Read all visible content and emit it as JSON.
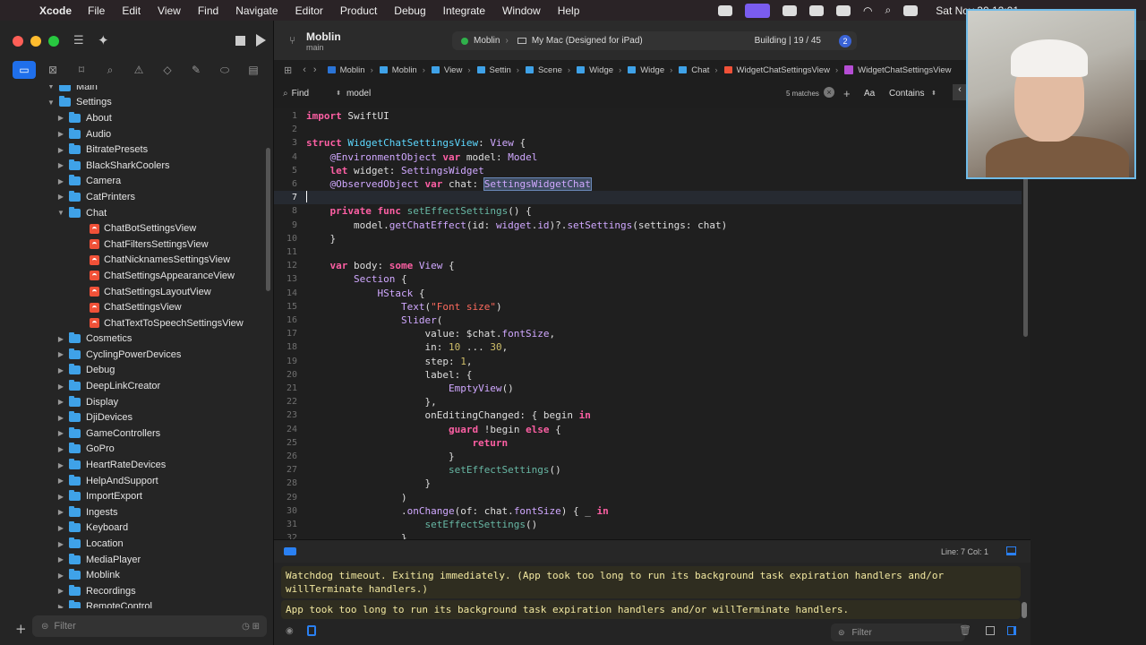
{
  "menubar": {
    "app": "Xcode",
    "items": [
      "File",
      "Edit",
      "View",
      "Find",
      "Navigate",
      "Editor",
      "Product",
      "Debug",
      "Integrate",
      "Window",
      "Help"
    ],
    "clock": "Sat Nov 30 12:01"
  },
  "toolbar": {
    "project": "Moblin",
    "branch": "main",
    "scheme": "Moblin",
    "destination": "My Mac (Designed for iPad)",
    "status": "Building | 19 / 45",
    "badge": "2"
  },
  "navigator": {
    "rows": [
      {
        "label": "Main",
        "depth": 1,
        "kind": "folder",
        "open": true
      },
      {
        "label": "Settings",
        "depth": 1,
        "kind": "folder",
        "open": true
      },
      {
        "label": "About",
        "depth": 2,
        "kind": "folder"
      },
      {
        "label": "Audio",
        "depth": 2,
        "kind": "folder"
      },
      {
        "label": "BitratePresets",
        "depth": 2,
        "kind": "folder"
      },
      {
        "label": "BlackSharkCoolers",
        "depth": 2,
        "kind": "folder"
      },
      {
        "label": "Camera",
        "depth": 2,
        "kind": "folder"
      },
      {
        "label": "CatPrinters",
        "depth": 2,
        "kind": "folder"
      },
      {
        "label": "Chat",
        "depth": 2,
        "kind": "folder",
        "open": true
      },
      {
        "label": "ChatBotSettingsView",
        "depth": 3,
        "kind": "swift"
      },
      {
        "label": "ChatFiltersSettingsView",
        "depth": 3,
        "kind": "swift"
      },
      {
        "label": "ChatNicknamesSettingsView",
        "depth": 3,
        "kind": "swift"
      },
      {
        "label": "ChatSettingsAppearanceView",
        "depth": 3,
        "kind": "swift"
      },
      {
        "label": "ChatSettingsLayoutView",
        "depth": 3,
        "kind": "swift"
      },
      {
        "label": "ChatSettingsView",
        "depth": 3,
        "kind": "swift"
      },
      {
        "label": "ChatTextToSpeechSettingsView",
        "depth": 3,
        "kind": "swift"
      },
      {
        "label": "Cosmetics",
        "depth": 2,
        "kind": "folder"
      },
      {
        "label": "CyclingPowerDevices",
        "depth": 2,
        "kind": "folder"
      },
      {
        "label": "Debug",
        "depth": 2,
        "kind": "folder"
      },
      {
        "label": "DeepLinkCreator",
        "depth": 2,
        "kind": "folder"
      },
      {
        "label": "Display",
        "depth": 2,
        "kind": "folder"
      },
      {
        "label": "DjiDevices",
        "depth": 2,
        "kind": "folder"
      },
      {
        "label": "GameControllers",
        "depth": 2,
        "kind": "folder"
      },
      {
        "label": "GoPro",
        "depth": 2,
        "kind": "folder"
      },
      {
        "label": "HeartRateDevices",
        "depth": 2,
        "kind": "folder"
      },
      {
        "label": "HelpAndSupport",
        "depth": 2,
        "kind": "folder"
      },
      {
        "label": "ImportExport",
        "depth": 2,
        "kind": "folder"
      },
      {
        "label": "Ingests",
        "depth": 2,
        "kind": "folder"
      },
      {
        "label": "Keyboard",
        "depth": 2,
        "kind": "folder"
      },
      {
        "label": "Location",
        "depth": 2,
        "kind": "folder"
      },
      {
        "label": "MediaPlayer",
        "depth": 2,
        "kind": "folder"
      },
      {
        "label": "Moblink",
        "depth": 2,
        "kind": "folder"
      },
      {
        "label": "Recordings",
        "depth": 2,
        "kind": "folder"
      },
      {
        "label": "RemoteControl",
        "depth": 2,
        "kind": "folder"
      }
    ],
    "filter_placeholder": "Filter"
  },
  "jumpbar": [
    "Moblin",
    "Moblin",
    "View",
    "Settin",
    "Scene",
    "Widge",
    "Widge",
    "Chat",
    "WidgetChatSettingsView",
    "WidgetChatSettingsView"
  ],
  "find": {
    "mode": "Find",
    "query": "model",
    "matches": "5 matches",
    "option": "Contains",
    "case_label": "Aa"
  },
  "code": {
    "current_line": 7,
    "lines": [
      [
        [
          "kw",
          "import"
        ],
        [
          "c",
          " SwiftUI"
        ]
      ],
      [],
      [
        [
          "kw",
          "struct"
        ],
        [
          "c",
          " "
        ],
        [
          "tp",
          "WidgetChatSettingsView"
        ],
        [
          "c",
          ": "
        ],
        [
          "ty",
          "View"
        ],
        [
          "c",
          " {"
        ]
      ],
      [
        [
          "c",
          "    "
        ],
        [
          "at",
          "@EnvironmentObject"
        ],
        [
          "c",
          " "
        ],
        [
          "kw",
          "var"
        ],
        [
          "c",
          " model: "
        ],
        [
          "ty",
          "Model"
        ]
      ],
      [
        [
          "c",
          "    "
        ],
        [
          "kw",
          "let"
        ],
        [
          "c",
          " widget: "
        ],
        [
          "ty",
          "SettingsWidget"
        ]
      ],
      [
        [
          "c",
          "    "
        ],
        [
          "at",
          "@ObservedObject"
        ],
        [
          "c",
          " "
        ],
        [
          "kw",
          "var"
        ],
        [
          "c",
          " chat: "
        ],
        [
          "hl",
          "SettingsWidgetChat"
        ]
      ],
      [
        [
          "caret",
          ""
        ]
      ],
      [
        [
          "c",
          "    "
        ],
        [
          "kw",
          "private"
        ],
        [
          "c",
          " "
        ],
        [
          "kw",
          "func"
        ],
        [
          "c",
          " "
        ],
        [
          "fn",
          "setEffectSettings"
        ],
        [
          "c",
          "() {"
        ]
      ],
      [
        [
          "c",
          "        model."
        ],
        [
          "ty",
          "getChatEffect"
        ],
        [
          "c",
          "(id: "
        ],
        [
          "ty",
          "widget"
        ],
        [
          "c",
          "."
        ],
        [
          "ty",
          "id"
        ],
        [
          "c",
          ")?."
        ],
        [
          "ty",
          "setSettings"
        ],
        [
          "c",
          "(settings: chat)"
        ]
      ],
      [
        [
          "c",
          "    }"
        ]
      ],
      [],
      [
        [
          "c",
          "    "
        ],
        [
          "kw",
          "var"
        ],
        [
          "c",
          " body: "
        ],
        [
          "kw",
          "some"
        ],
        [
          "c",
          " "
        ],
        [
          "ty",
          "View"
        ],
        [
          "c",
          " {"
        ]
      ],
      [
        [
          "c",
          "        "
        ],
        [
          "ty",
          "Section"
        ],
        [
          "c",
          " {"
        ]
      ],
      [
        [
          "c",
          "            "
        ],
        [
          "ty",
          "HStack"
        ],
        [
          "c",
          " {"
        ]
      ],
      [
        [
          "c",
          "                "
        ],
        [
          "ty",
          "Text"
        ],
        [
          "c",
          "("
        ],
        [
          "st",
          "\"Font size\""
        ],
        [
          "c",
          ")"
        ]
      ],
      [
        [
          "c",
          "                "
        ],
        [
          "ty",
          "Slider"
        ],
        [
          "c",
          "("
        ]
      ],
      [
        [
          "c",
          "                    value: $chat."
        ],
        [
          "ty",
          "fontSize"
        ],
        [
          "c",
          ","
        ]
      ],
      [
        [
          "c",
          "                    in: "
        ],
        [
          "nu",
          "10"
        ],
        [
          "c",
          " ... "
        ],
        [
          "nu",
          "30"
        ],
        [
          "c",
          ","
        ]
      ],
      [
        [
          "c",
          "                    step: "
        ],
        [
          "nu",
          "1"
        ],
        [
          "c",
          ","
        ]
      ],
      [
        [
          "c",
          "                    label: {"
        ]
      ],
      [
        [
          "c",
          "                        "
        ],
        [
          "ty",
          "EmptyView"
        ],
        [
          "c",
          "()"
        ]
      ],
      [
        [
          "c",
          "                    },"
        ]
      ],
      [
        [
          "c",
          "                    onEditingChanged: { begin "
        ],
        [
          "kw",
          "in"
        ]
      ],
      [
        [
          "c",
          "                        "
        ],
        [
          "kw",
          "guard"
        ],
        [
          "c",
          " !begin "
        ],
        [
          "kw",
          "else"
        ],
        [
          "c",
          " {"
        ]
      ],
      [
        [
          "c",
          "                            "
        ],
        [
          "kw",
          "return"
        ]
      ],
      [
        [
          "c",
          "                        }"
        ]
      ],
      [
        [
          "c",
          "                        "
        ],
        [
          "fn",
          "setEffectSettings"
        ],
        [
          "c",
          "()"
        ]
      ],
      [
        [
          "c",
          "                    }"
        ]
      ],
      [
        [
          "c",
          "                )"
        ]
      ],
      [
        [
          "c",
          "                ."
        ],
        [
          "ty",
          "onChange"
        ],
        [
          "c",
          "(of: chat."
        ],
        [
          "ty",
          "fontSize"
        ],
        [
          "c",
          ") { _ "
        ],
        [
          "kw",
          "in"
        ]
      ],
      [
        [
          "c",
          "                    "
        ],
        [
          "fn",
          "setEffectSettings"
        ],
        [
          "c",
          "()"
        ]
      ],
      [
        [
          "c",
          "                }"
        ]
      ]
    ]
  },
  "debugbar": {
    "position": "Line: 7  Col: 1"
  },
  "console": {
    "messages": [
      "Watchdog timeout. Exiting immediately. (App took too long to run its background task expiration handlers and/or willTerminate handlers.)",
      "App took too long to run its background task expiration handlers and/or willTerminate handlers."
    ],
    "filter_placeholder": "Filter"
  }
}
